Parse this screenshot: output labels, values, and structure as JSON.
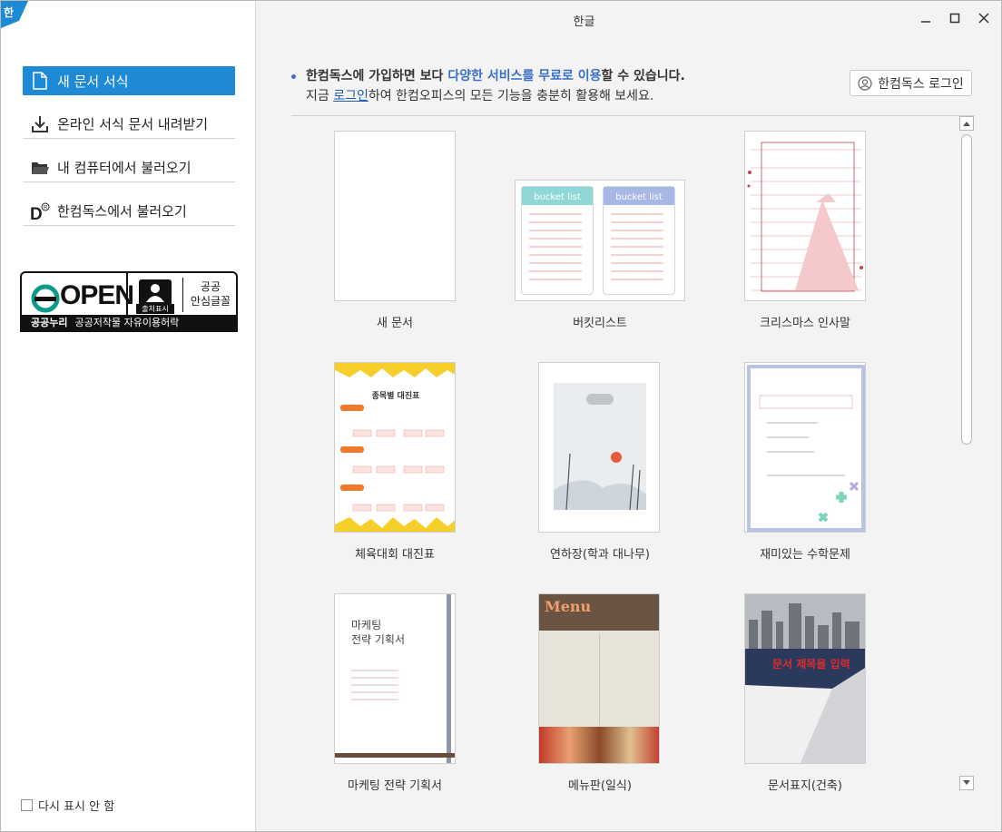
{
  "window": {
    "title": "한글",
    "app_badge": "한"
  },
  "sidebar": {
    "items": [
      {
        "label": "새 문서 서식",
        "icon": "document-icon",
        "active": true
      },
      {
        "label": "온라인 서식 문서 내려받기",
        "icon": "download-icon",
        "active": false
      },
      {
        "label": "내 컴퓨터에서 불러오기",
        "icon": "folder-icon",
        "active": false
      },
      {
        "label": "한컴독스에서 불러오기",
        "icon": "hancom-docs-icon",
        "active": false
      }
    ],
    "open_badge": {
      "word": "OPEN",
      "person_label": "출처표시",
      "right_text_1": "공공",
      "right_text_2": "안심글꼴",
      "bar_bold": "공공누리",
      "bar_text": "공공저작물 자유이용허락"
    },
    "dont_show_label": "다시 표시 안 함"
  },
  "info": {
    "line1_pre": "한컴독스에 가입하면 보다 ",
    "line1_highlight": "다양한 서비스를 무료로 이용",
    "line1_post": "할 수 있습니다.",
    "line2_pre": "지금 ",
    "line2_link": "로그인",
    "line2_post": "하여 한컴오피스의 모든 기능을 충분히 활용해 보세요."
  },
  "login_button": "한컴독스 로그인",
  "templates": [
    {
      "label": "새 문서"
    },
    {
      "label": "버킷리스트",
      "inner_a": "bucket list",
      "inner_b": "bucket list"
    },
    {
      "label": "크리스마스 인사말"
    },
    {
      "label": "체육대회 대진표",
      "inner_title": "종목별 대진표"
    },
    {
      "label": "연하장(학과 대나무)"
    },
    {
      "label": "재미있는 수학문제"
    },
    {
      "label": "마케팅 전략 기획서",
      "inner_title_1": "마케팅",
      "inner_title_2": "전략 기획서"
    },
    {
      "label": "메뉴판(일식)",
      "inner_title": "Menu"
    },
    {
      "label": "문서표지(건축)",
      "inner_title": "문서 제목을 입력"
    }
  ],
  "colors": {
    "accent": "#1e8ad6",
    "link": "#3a6fc9"
  }
}
